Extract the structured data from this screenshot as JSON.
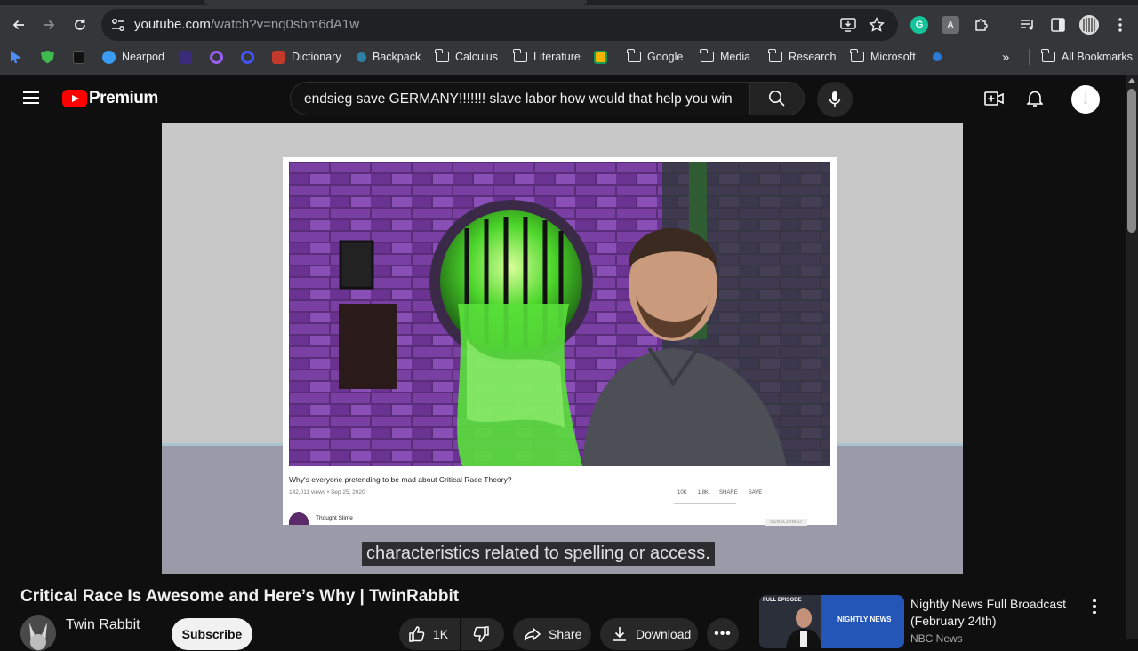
{
  "browser": {
    "url_host": "youtube.com",
    "url_path": "/watch?v=nq0sbm6dA1w",
    "bookmarks": [
      {
        "label": "Nearpod",
        "icon": "nearpod-icon"
      },
      {
        "label": "Dictionary",
        "icon": "dictionary-icon"
      },
      {
        "label": "Backpack",
        "icon": "backpack-icon"
      },
      {
        "label": "Calculus",
        "icon": "folder-icon"
      },
      {
        "label": "Literature",
        "icon": "folder-icon"
      },
      {
        "label": "Google",
        "icon": "folder-icon"
      },
      {
        "label": "Media",
        "icon": "folder-icon"
      },
      {
        "label": "Research",
        "icon": "folder-icon"
      },
      {
        "label": "Microsoft",
        "icon": "folder-icon"
      }
    ],
    "all_bookmarks_label": "All Bookmarks",
    "overflow_label": "»"
  },
  "youtube": {
    "brand": "Premium",
    "search_query": "endsieg save GERMANY!!!!!!! slave labor how would that help you win",
    "caption": "characteristics related to spelling or access.",
    "inner_video": {
      "title": "Why's everyone pretending to be mad about Critical Race Theory?",
      "meta": "142,011 views • Sep 25, 2020",
      "likes": "10K",
      "dislikes": "1.8K",
      "share": "SHARE",
      "save": "SAVE",
      "channel": "Thought Slime",
      "subscribed": "SUBSCRIBED"
    },
    "video": {
      "title": "Critical Race Is Awesome and Here’s Why | TwinRabbit",
      "channel": "Twin Rabbit",
      "subscribe_label": "Subscribe",
      "like_count": "1K",
      "share_label": "Share",
      "download_label": "Download",
      "more_label": "•••"
    },
    "recommendation": {
      "title": "Nightly News Full Broadcast (February 24th)",
      "channel": "NBC News",
      "badge": "FULL EPISODE",
      "thumb_text": "NIGHTLY NEWS"
    }
  },
  "colors": {
    "chrome_bg": "#35363a",
    "youtube_bg": "#0f0f0f",
    "youtube_red": "#ff0000",
    "grammarly_green": "#15c39a"
  }
}
